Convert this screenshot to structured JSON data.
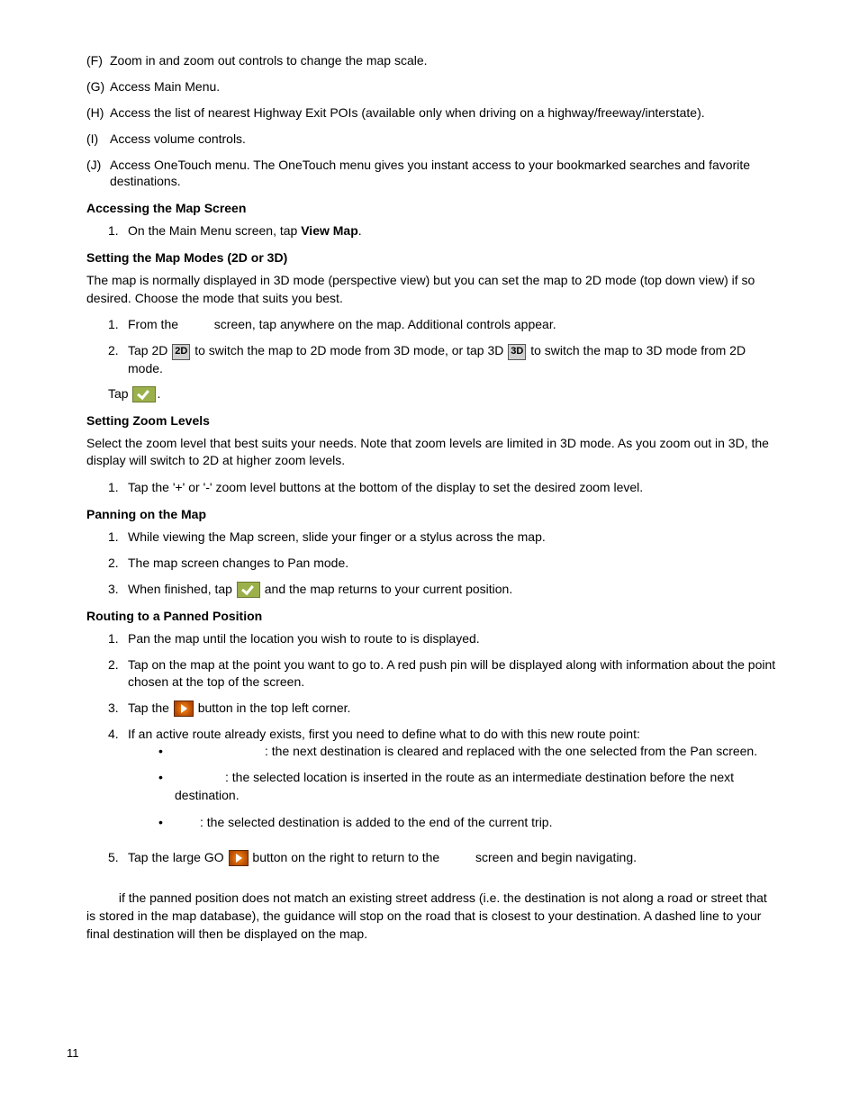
{
  "lettered": [
    {
      "letter": "(F)",
      "text": "Zoom in and zoom out controls to change the map scale."
    },
    {
      "letter": "(G)",
      "text": "Access Main Menu."
    },
    {
      "letter": "(H)",
      "text": "Access the list of nearest Highway Exit POIs (available only when driving on a highway/freeway/interstate)."
    },
    {
      "letter": "(I)",
      "text": "Access volume controls."
    },
    {
      "letter": "(J)",
      "text": "Access OneTouch menu. The OneTouch menu gives you instant access to your bookmarked searches and favorite destinations."
    }
  ],
  "sec1": {
    "heading": "Accessing the Map Screen",
    "step1_num": "1.",
    "step1_a": "On the Main Menu screen, tap ",
    "step1_b": "View Map",
    "step1_c": "."
  },
  "sec2": {
    "heading": "Setting the Map Modes (2D or 3D)",
    "para": "The map is normally displayed in 3D mode (perspective view) but you can set the map to 2D mode (top down view) if so desired. Choose the mode that suits you best.",
    "s1_num": "1.",
    "s1_a": "From the ",
    "s1_b": " screen, tap anywhere on the map. Additional controls appear.",
    "s2_num": "2.",
    "s2_a": "Tap 2D ",
    "s2_b": " to switch the map to 2D mode from 3D mode, or tap 3D ",
    "s2_c": " to switch the map to 3D mode from 2D mode.",
    "tap": "Tap ",
    "tap_end": ".",
    "icon2d": "2D",
    "icon3d": "3D"
  },
  "sec3": {
    "heading": "Setting Zoom Levels",
    "para": "Select the zoom level that best suits your needs.  Note that zoom levels are limited in 3D mode.  As you zoom out in 3D, the display will switch to 2D at higher zoom levels.",
    "s1_num": "1.",
    "s1": "Tap the '+' or '-' zoom level buttons at the bottom of the display to set the desired zoom level."
  },
  "sec4": {
    "heading": "Panning on the Map",
    "s1_num": "1.",
    "s1": "While viewing the Map screen, slide your finger or a stylus across the map.",
    "s2_num": "2.",
    "s2": "The map screen changes to Pan mode.",
    "s3_num": "3.",
    "s3_a": "When finished, tap ",
    "s3_b": " and the map returns to your current position."
  },
  "sec5": {
    "heading": "Routing to a Panned Position",
    "s1_num": "1.",
    "s1": "Pan the map until the location you wish to route to is displayed.",
    "s2_num": "2.",
    "s2": "Tap on the map at the point you want to go to.  A red push pin will be displayed along with information about the point chosen at the top of the screen.",
    "s3_num": "3.",
    "s3_a": "Tap the ",
    "s3_b": " button in the top left corner.",
    "s4_num": "4.",
    "s4": "If an active route already exists, first you need to define what to do with this new route point:",
    "b1": ": the next destination is cleared and replaced with the one selected from the Pan screen.",
    "b2": ": the selected location is inserted in the route as an intermediate destination before the next destination.",
    "b3": ": the selected destination is added to the end of the current trip.",
    "s5_num": "5.",
    "s5_a": "Tap the large GO ",
    "s5_b": " button on the right to return to the ",
    "s5_c": " screen and begin navigating."
  },
  "note": " if the panned position does not match an existing street address (i.e. the destination is not along a road or street that is stored in the map database), the guidance will stop on the road that is closest to your destination. A dashed line to your final destination will then be displayed on the map.",
  "page_number": "11"
}
